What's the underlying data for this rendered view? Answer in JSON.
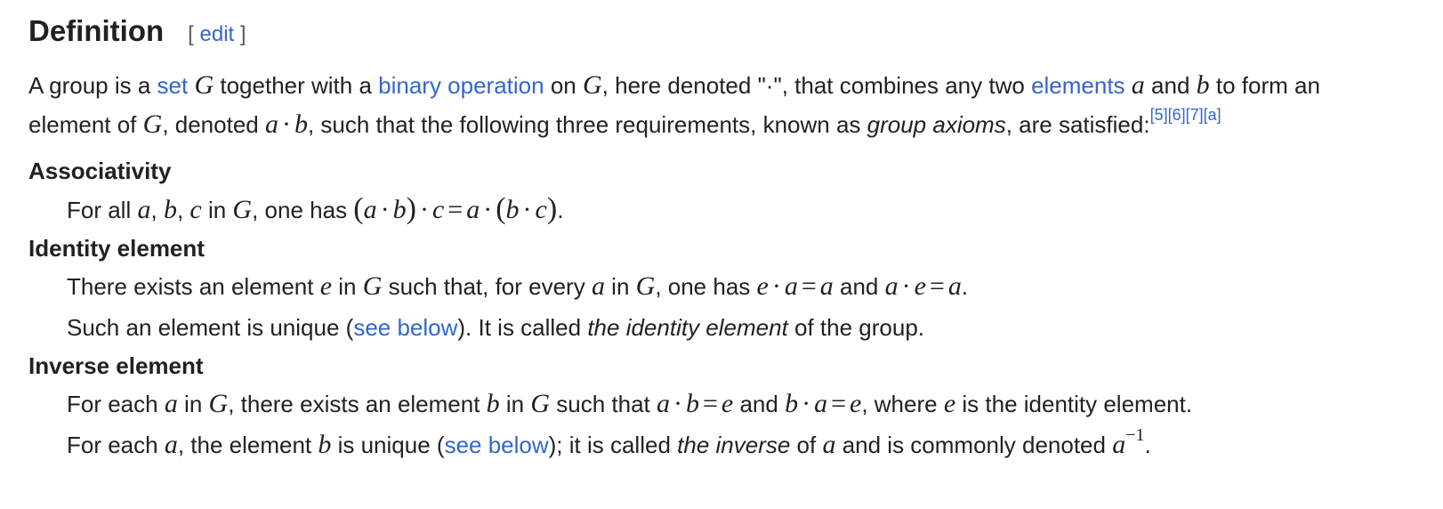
{
  "section": {
    "title": "Definition",
    "edit_open": "[",
    "edit_label": "edit",
    "edit_close": "]"
  },
  "intro": {
    "t1": "A group is a ",
    "link_set": "set",
    "t2": " together with a ",
    "link_binop": "binary operation",
    "t3": " on ",
    "t4": ", here denoted \"·\", that combines any two ",
    "link_elements": "elements",
    "t5": " and ",
    "t6": " to form an element of ",
    "t7": ", denoted ",
    "t8": ", such that the following three requirements, known as ",
    "em_axioms": "group axioms",
    "t9": ", are satisfied:",
    "refs": [
      "[5]",
      "[6]",
      "[7]",
      "[a]"
    ]
  },
  "math": {
    "G": "G",
    "a": "a",
    "b": "b",
    "c": "c",
    "e": "e",
    "dot": "·",
    "eq": "=",
    "lparen": "(",
    "rparen": ")",
    "comma": ",",
    "inv_exp": "−1"
  },
  "associativity": {
    "term": "Associativity",
    "t1": "For all ",
    "t2": " in ",
    "t3": ", one has ",
    "end": "."
  },
  "identity": {
    "term": "Identity element",
    "l1_t1": "There exists an element ",
    "l1_t2": " in ",
    "l1_t3": " such that, for every ",
    "l1_t4": " in ",
    "l1_t5": ", one has ",
    "l1_t6": " and ",
    "l1_end": ".",
    "l2_t1": "Such an element is unique (",
    "l2_link": "see below",
    "l2_t2": "). It is called ",
    "l2_em": "the identity element",
    "l2_t3": " of the group."
  },
  "inverse": {
    "term": "Inverse element",
    "l1_t1": "For each ",
    "l1_t2": " in ",
    "l1_t3": ", there exists an element ",
    "l1_t4": " in ",
    "l1_t5": " such that ",
    "l1_t6": " and ",
    "l1_t7": ", where ",
    "l1_t8": " is the identity element.",
    "l2_t1": "For each ",
    "l2_t2": ", the element ",
    "l2_t3": " is unique (",
    "l2_link": "see below",
    "l2_t4": "); it is called ",
    "l2_em": "the inverse",
    "l2_t5": " of ",
    "l2_t6": " and is commonly denoted ",
    "l2_end": "."
  }
}
